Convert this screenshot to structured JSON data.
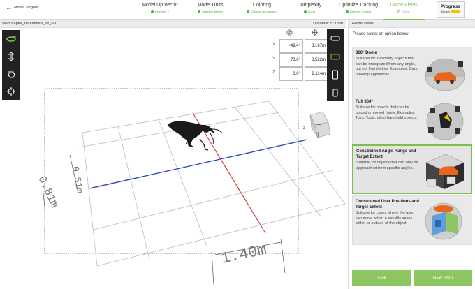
{
  "app": {
    "back_glyph": "←",
    "title": "Model Targets"
  },
  "steps": [
    {
      "name": "Model Up Vector",
      "status": "Selected: Y"
    },
    {
      "name": "Model Units",
      "status": "Selected: Meters"
    },
    {
      "name": "Coloring",
      "status": "Coloring not required"
    },
    {
      "name": "Complexity",
      "status": "Good"
    },
    {
      "name": "Optimize Tracking",
      "status": "Selected: Default"
    },
    {
      "name": "Guide Views",
      "status": "Ready"
    }
  ],
  "progress": {
    "label": "Progress",
    "level_label": "Medium"
  },
  "viewport": {
    "model_name": "Velociraptor_rescanned_for_MT",
    "distance": "Distance: 5.305m"
  },
  "coords": {
    "x": {
      "axis": "X",
      "angle": "-49.4°",
      "dist": "3.167m"
    },
    "y": {
      "axis": "Y",
      "angle": "73.6°",
      "dist": "3.522m"
    },
    "z": {
      "axis": "Z",
      "angle": "0.0°",
      "dist": "2.114m"
    }
  },
  "scene": {
    "dim_width": "1.40m",
    "dim_height": "0.51m",
    "dim_depth": "0.81m",
    "cube_axis": "z"
  },
  "panel": {
    "header": "Guide Views",
    "prompt": "Please select an option below:",
    "options": [
      {
        "title": "360° Dome",
        "desc": "Suitable for stationary objects that can be recognized from any angle, but not from below. Examples: Cars, tabletop appliances."
      },
      {
        "title": "Full 360°",
        "desc": "Suitable for objects that can be placed or moved freely. Examples: Toys, Tools, other handheld objects."
      },
      {
        "title": "Constrained Angle Range and Target Extent",
        "desc": "Suitable for objects that can only be approached from specific angles."
      },
      {
        "title": "Constrained User Positions and Target Extent",
        "desc": "Suitable for cases where the user can move within a specific space within or outside of the object."
      }
    ],
    "back": "Back",
    "next": "Next Step"
  },
  "colors": {
    "accent": "#7cc04b",
    "button": "#8dc560",
    "axis_x": "#d23c3c",
    "axis_y": "#2e9b3a",
    "axis_z": "#2a3fc4",
    "progress": "#f5c400"
  }
}
